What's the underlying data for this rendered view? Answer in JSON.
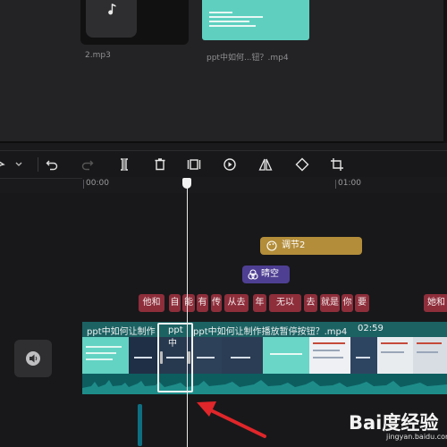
{
  "media": {
    "items": [
      {
        "name": "2.mp3",
        "type": "audio",
        "icon": "music-note-icon"
      },
      {
        "name": "ppt中如何...钮？.mp4",
        "type": "video"
      }
    ]
  },
  "toolbar": {
    "buttons": [
      {
        "name": "cursor-tool",
        "icon": "cursor-icon"
      },
      {
        "name": "undo",
        "icon": "undo-icon"
      },
      {
        "name": "redo",
        "icon": "redo-icon",
        "enabled": false
      },
      {
        "name": "split",
        "icon": "split-icon"
      },
      {
        "name": "delete",
        "icon": "trash-icon"
      },
      {
        "name": "freeze-frame",
        "icon": "freeze-frame-icon"
      },
      {
        "name": "reverse",
        "icon": "reverse-play-icon"
      },
      {
        "name": "mirror",
        "icon": "mirror-icon"
      },
      {
        "name": "rotate",
        "icon": "rotate-icon"
      },
      {
        "name": "crop",
        "icon": "crop-icon"
      }
    ]
  },
  "ruler": {
    "labels": [
      "00:00",
      "01:00"
    ]
  },
  "effects": {
    "adjust_label": "调节2",
    "clear_label": "晴空"
  },
  "subtitles": [
    {
      "text": "他和"
    },
    {
      "text": "自"
    },
    {
      "text": "能"
    },
    {
      "text": "有"
    },
    {
      "text": "传"
    },
    {
      "text": "从去"
    },
    {
      "text": "年"
    },
    {
      "text": "无以"
    },
    {
      "text": "去"
    },
    {
      "text": "就是"
    },
    {
      "text": "你"
    },
    {
      "text": "要"
    },
    {
      "text": "她和"
    }
  ],
  "track": {
    "clip_title": "ppt中如何让制作",
    "clip_title_2": "ppt中如何让制作播放暂停按钮？.mp4",
    "duration": "02:59"
  },
  "selected_segment": {
    "title": "ppt中"
  },
  "colors": {
    "track": "#106f6f",
    "subtitle": "#8e2e3b",
    "adjust": "#b38d3a",
    "filter": "#4f3f93",
    "arrow": "#e0262a"
  },
  "watermark": {
    "text": "Bai度经验",
    "sub": "jingyan.baidu.com"
  }
}
